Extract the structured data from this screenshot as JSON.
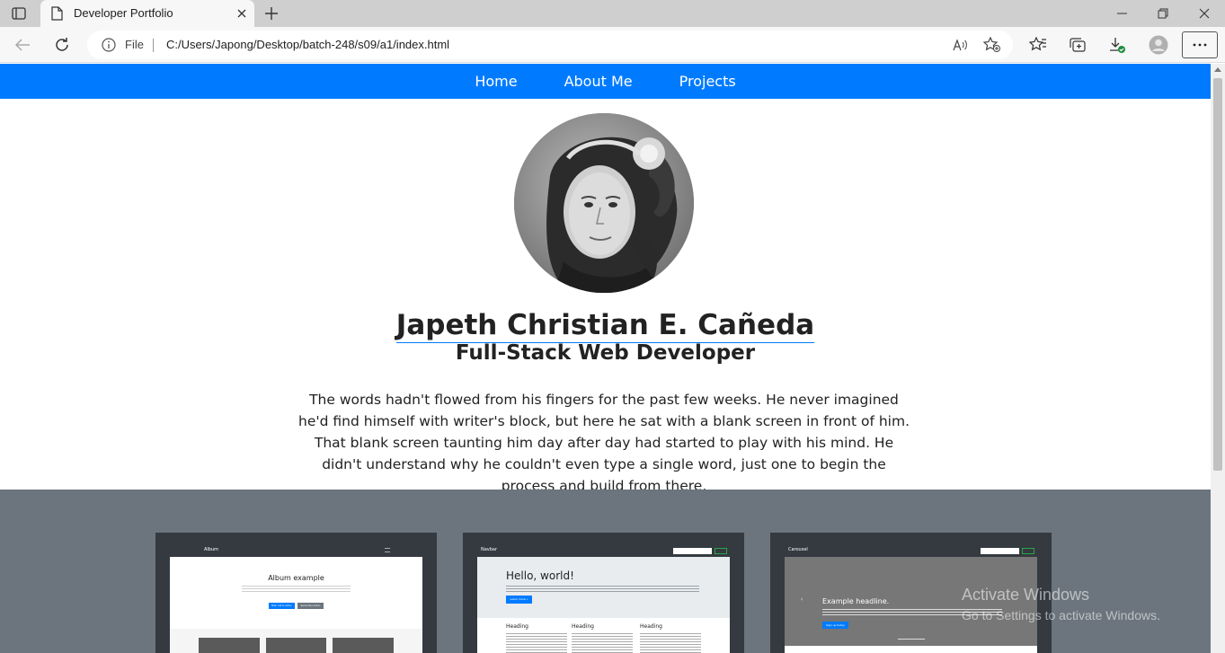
{
  "browser": {
    "tab_title": "Developer Portfolio",
    "address": {
      "scheme_label": "File",
      "url": "C:/Users/Japong/Desktop/batch-248/s09/a1/index.html"
    }
  },
  "site": {
    "nav": [
      "Home",
      "About Me",
      "Projects"
    ],
    "name": "Japeth Christian E. Cañeda",
    "role": "Full-Stack Web Developer",
    "bio": "The words hadn't flowed from his fingers for the past few weeks. He never imagined he'd find himself with writer's block, but here he sat with a blank screen in front of him. That blank screen taunting him day after day had started to play with his mind. He didn't understand why he couldn't even type a single word, just one to begin the process and build from there."
  },
  "project_cards": [
    {
      "header_brand": "Album",
      "heading": "Album example",
      "primary_btn": "Main call to action",
      "secondary_btn": "Secondary action"
    },
    {
      "header_brand": "Navbar",
      "heading": "Hello, world!",
      "primary_btn": "Learn more »",
      "col_headings": [
        "Heading",
        "Heading",
        "Heading"
      ]
    },
    {
      "header_brand": "Carousel",
      "heading": "Example headline.",
      "primary_btn": "Sign up today"
    }
  ],
  "watermark": {
    "line1": "Activate Windows",
    "line2": "Go to Settings to activate Windows."
  },
  "colors": {
    "nav_bg": "#007bff",
    "projects_bg": "#6c757d",
    "card_bg": "#343a40"
  }
}
